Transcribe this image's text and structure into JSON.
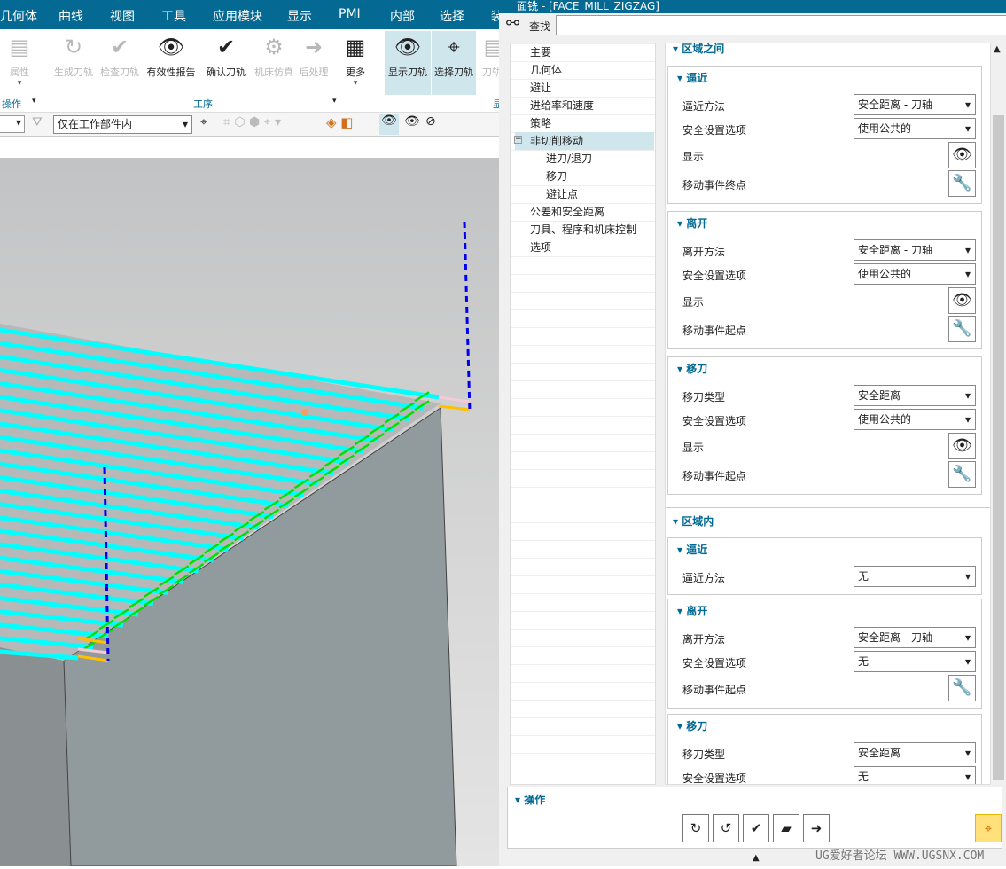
{
  "menubar": {
    "items": [
      "几何体",
      "曲线",
      "视图",
      "工具",
      "应用模块",
      "显示",
      "PMI",
      "内部",
      "选择",
      "装"
    ]
  },
  "ribbon": {
    "buttons": [
      {
        "label": "属性",
        "icon": "properties-icon",
        "enabled": false
      },
      {
        "label": "生成刀轨",
        "icon": "generate-toolpath-icon",
        "enabled": false
      },
      {
        "label": "检查刀轨",
        "icon": "verify-toolpath-icon",
        "enabled": false
      },
      {
        "label": "有效性报告",
        "icon": "validity-report-icon",
        "enabled": true
      },
      {
        "label": "确认刀轨",
        "icon": "confirm-toolpath-icon",
        "enabled": true
      },
      {
        "label": "机床仿真",
        "icon": "machine-simulation-icon",
        "enabled": false
      },
      {
        "label": "后处理",
        "icon": "postprocess-icon",
        "enabled": false
      },
      {
        "label": "更多",
        "icon": "more-icon",
        "enabled": true
      },
      {
        "label": "显示刀轨",
        "icon": "show-toolpath-icon",
        "enabled": true
      },
      {
        "label": "选择刀轨",
        "icon": "select-toolpath-icon",
        "enabled": true
      },
      {
        "label": "刀轨",
        "icon": "toolpath-icon",
        "enabled": false
      }
    ],
    "groups": [
      "操作",
      "工序",
      "显"
    ]
  },
  "toolbar2": {
    "filter_value": "仅在工作部件内"
  },
  "dialog": {
    "title": "面铣 - [FACE_MILL_ZIGZAG]",
    "search_label": "查找",
    "search_value": "",
    "tree": [
      {
        "label": "主要",
        "level": 0
      },
      {
        "label": "几何体",
        "level": 0
      },
      {
        "label": "避让",
        "level": 0
      },
      {
        "label": "进给率和速度",
        "level": 0
      },
      {
        "label": "策略",
        "level": 0
      },
      {
        "label": "非切削移动",
        "level": 0,
        "selected": true,
        "expanded": true
      },
      {
        "label": "进刀/退刀",
        "level": 1
      },
      {
        "label": "移刀",
        "level": 1
      },
      {
        "label": "避让点",
        "level": 1
      },
      {
        "label": "公差和安全距离",
        "level": 0
      },
      {
        "label": "刀具、程序和机床控制",
        "level": 0
      },
      {
        "label": "选项",
        "level": 0
      }
    ],
    "sections": [
      {
        "title": "区域之间",
        "groups": [
          {
            "title": "逼近",
            "rows": [
              {
                "label": "逼近方法",
                "type": "select",
                "value": "安全距离 - 刀轴"
              },
              {
                "label": "安全设置选项",
                "type": "select",
                "value": "使用公共的"
              },
              {
                "label": "显示",
                "type": "icon",
                "icon": "eye-icon"
              },
              {
                "label": "移动事件终点",
                "type": "icon",
                "icon": "wrench-icon"
              }
            ]
          },
          {
            "title": "离开",
            "rows": [
              {
                "label": "离开方法",
                "type": "select",
                "value": "安全距离 - 刀轴"
              },
              {
                "label": "安全设置选项",
                "type": "select",
                "value": "使用公共的"
              },
              {
                "label": "显示",
                "type": "icon",
                "icon": "eye-icon"
              },
              {
                "label": "移动事件起点",
                "type": "icon",
                "icon": "wrench-icon"
              }
            ]
          },
          {
            "title": "移刀",
            "rows": [
              {
                "label": "移刀类型",
                "type": "select",
                "value": "安全距离"
              },
              {
                "label": "安全设置选项",
                "type": "select",
                "value": "使用公共的"
              },
              {
                "label": "显示",
                "type": "icon",
                "icon": "eye-icon"
              },
              {
                "label": "移动事件起点",
                "type": "icon",
                "icon": "wrench-icon"
              }
            ]
          }
        ]
      },
      {
        "title": "区域内",
        "groups": [
          {
            "title": "逼近",
            "rows": [
              {
                "label": "逼近方法",
                "type": "select",
                "value": "无"
              }
            ]
          },
          {
            "title": "离开",
            "rows": [
              {
                "label": "离开方法",
                "type": "select",
                "value": "安全距离 - 刀轴"
              },
              {
                "label": "安全设置选项",
                "type": "select",
                "value": "无"
              },
              {
                "label": "移动事件起点",
                "type": "icon",
                "icon": "wrench-icon"
              }
            ]
          },
          {
            "title": "移刀",
            "rows": [
              {
                "label": "移刀类型",
                "type": "select",
                "value": "安全距离"
              },
              {
                "label": "安全设置选项",
                "type": "select",
                "value": "无"
              }
            ]
          }
        ]
      }
    ],
    "operations": {
      "title": "操作",
      "buttons": [
        "generate-icon",
        "replay-icon",
        "verify-icon",
        "simulate-icon",
        "list-icon"
      ],
      "select_button": "select-toolpath-icon"
    }
  },
  "watermark": "UG爱好者论坛 WWW.UGSNX.COM",
  "colors": {
    "accent": "#046a93",
    "toolpath": "#00ffff",
    "engage": "#00e000",
    "rapid": "#0000ee",
    "highlight": "#ffe07a"
  }
}
